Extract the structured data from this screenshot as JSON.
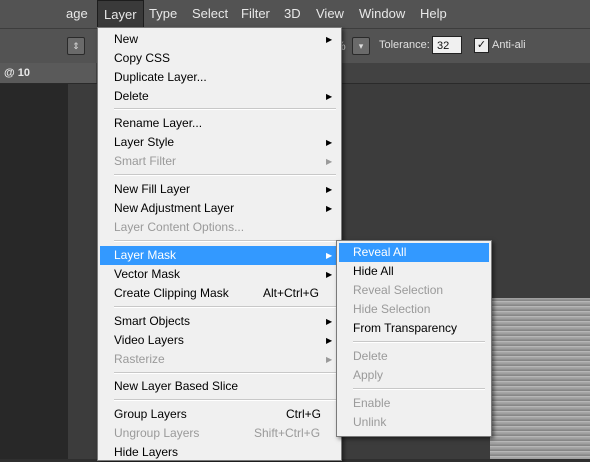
{
  "menubar": {
    "items": [
      "age",
      "Layer",
      "Type",
      "Select",
      "Filter",
      "3D",
      "View",
      "Window",
      "Help"
    ]
  },
  "options": {
    "percent_suffix": "%",
    "tolerance_label": "Tolerance:",
    "tolerance_value": "32",
    "antialias_label": "Anti-ali",
    "antialias_checked": "✓"
  },
  "document": {
    "tab_label": "@ 10"
  },
  "layer_menu": {
    "items": [
      {
        "label": "New",
        "submenu": "▶",
        "enabled": true
      },
      {
        "label": "Copy CSS",
        "enabled": true
      },
      {
        "label": "Duplicate Layer...",
        "enabled": true
      },
      {
        "label": "Delete",
        "submenu": "▶",
        "enabled": true
      },
      {
        "label": "Rename Layer...",
        "enabled": true
      },
      {
        "label": "Layer Style",
        "submenu": "▶",
        "enabled": true
      },
      {
        "label": "Smart Filter",
        "submenu": "▶",
        "enabled": false
      },
      {
        "label": "New Fill Layer",
        "submenu": "▶",
        "enabled": true
      },
      {
        "label": "New Adjustment Layer",
        "submenu": "▶",
        "enabled": true
      },
      {
        "label": "Layer Content Options...",
        "enabled": false
      },
      {
        "label": "Layer Mask",
        "submenu": "▶",
        "enabled": true,
        "highlighted": true
      },
      {
        "label": "Vector Mask",
        "submenu": "▶",
        "enabled": true
      },
      {
        "label": "Create Clipping Mask",
        "shortcut": "Alt+Ctrl+G",
        "enabled": true
      },
      {
        "label": "Smart Objects",
        "submenu": "▶",
        "enabled": true
      },
      {
        "label": "Video Layers",
        "submenu": "▶",
        "enabled": true
      },
      {
        "label": "Rasterize",
        "submenu": "▶",
        "enabled": false
      },
      {
        "label": "New Layer Based Slice",
        "enabled": true
      },
      {
        "label": "Group Layers",
        "shortcut": "Ctrl+G",
        "enabled": true
      },
      {
        "label": "Ungroup Layers",
        "shortcut": "Shift+Ctrl+G",
        "enabled": false
      },
      {
        "label": "Hide Layers",
        "enabled": true
      }
    ]
  },
  "mask_submenu": {
    "items": [
      {
        "label": "Reveal All",
        "enabled": true,
        "highlighted": true
      },
      {
        "label": "Hide All",
        "enabled": true
      },
      {
        "label": "Reveal Selection",
        "enabled": false
      },
      {
        "label": "Hide Selection",
        "enabled": false
      },
      {
        "label": "From Transparency",
        "enabled": true
      },
      {
        "label": "Delete",
        "enabled": false
      },
      {
        "label": "Apply",
        "enabled": false
      },
      {
        "label": "Enable",
        "enabled": false
      },
      {
        "label": "Unlink",
        "enabled": false
      }
    ]
  },
  "colors": {
    "highlight": "#3399ff",
    "menu_bg": "#f0f0f0",
    "disabled_text": "#9a9a9a",
    "app_chrome": "#535353"
  }
}
